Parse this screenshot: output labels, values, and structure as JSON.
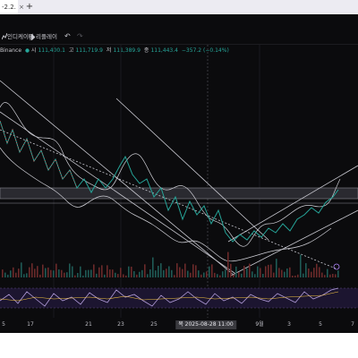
{
  "browser": {
    "tab_title": "-2.2.",
    "tab_close": "×",
    "new_tab": "+"
  },
  "toolbar": {
    "indicator_label": "인디케이터",
    "alerts_label": "얼러트",
    "replay_label": "리플레이",
    "undo": "↶",
    "redo": "↷"
  },
  "legend": {
    "exchange": "Binance",
    "open_label": "시",
    "open": "111,400.1",
    "high_label": "고",
    "high": "111,719.9",
    "low_label": "저",
    "low": "111,389.9",
    "close_label": "종",
    "close": "111,443.4",
    "change": "−357.2 (−0.14%)"
  },
  "time_axis": {
    "ticks": [
      "5",
      "17",
      "21",
      "23",
      "25",
      "9월",
      "3",
      "5",
      "7"
    ],
    "crosshair": "목 2025-08-28   11:00"
  },
  "colors": {
    "up": "#26a69a",
    "down": "#ef5350",
    "band": "#cfcfd6",
    "background": "#0b0b0d",
    "rsi": "#7e57c2"
  },
  "icons": [
    "indicator-icon",
    "alert-icon",
    "replay-icon",
    "undo-icon",
    "redo-icon",
    "exchange-icon"
  ]
}
